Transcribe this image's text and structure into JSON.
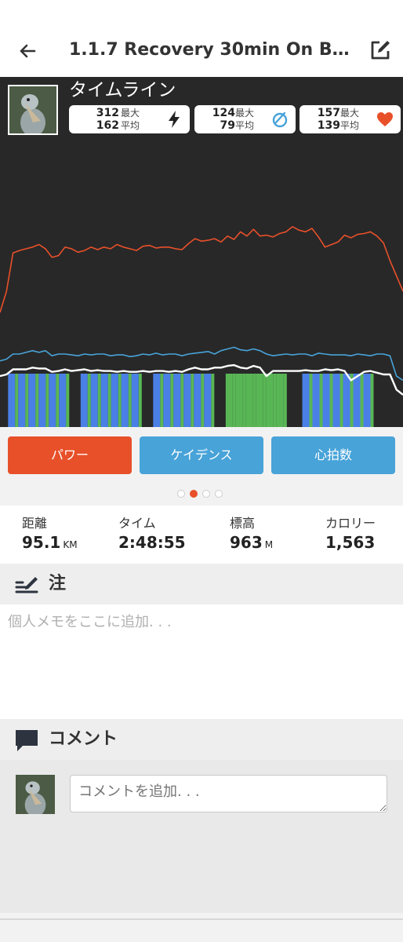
{
  "header": {
    "title": "1.1.7 Recovery 30min On B...",
    "back_icon": "arrow-left-icon",
    "edit_icon": "edit-icon"
  },
  "timeline": {
    "title": "タイムライン",
    "stats": [
      {
        "max": "312",
        "avg": "162",
        "max_label": "最大",
        "avg_label": "平均",
        "icon": "lightning-icon"
      },
      {
        "max": "124",
        "avg": "79",
        "max_label": "最大",
        "avg_label": "平均",
        "icon": "cadence-icon"
      },
      {
        "max": "157",
        "avg": "139",
        "max_label": "最大",
        "avg_label": "平均",
        "icon": "heart-icon"
      }
    ]
  },
  "chart_data": {
    "type": "line",
    "series": [
      {
        "name": "パワー",
        "color": "#e8502a",
        "values": [
          135,
          160,
          205,
          208,
          210,
          212,
          215,
          210,
          200,
          202,
          212,
          210,
          206,
          208,
          212,
          209,
          212,
          210,
          215,
          212,
          210,
          208,
          213,
          214,
          211,
          212,
          212,
          210,
          209,
          216,
          222,
          219,
          220,
          222,
          218,
          225,
          221,
          230,
          225,
          233,
          225,
          226,
          224,
          228,
          230,
          236,
          232,
          230,
          234,
          224,
          212,
          215,
          218,
          226,
          223,
          227,
          228,
          230,
          225,
          217,
          196,
          178,
          160
        ]
      },
      {
        "name": "ケイデンス",
        "color": "#48a3d8",
        "values": [
          78,
          80,
          86,
          86,
          88,
          90,
          88,
          90,
          84,
          86,
          86,
          85,
          84,
          86,
          85,
          86,
          86,
          84,
          85,
          85,
          83,
          84,
          86,
          85,
          87,
          85,
          86,
          86,
          84,
          86,
          87,
          88,
          89,
          86,
          90,
          92,
          94,
          91,
          90,
          92,
          90,
          86,
          84,
          85,
          86,
          85,
          86,
          86,
          84,
          87,
          86,
          85,
          85,
          85,
          84,
          86,
          85,
          84,
          86,
          86,
          84,
          60,
          55
        ]
      },
      {
        "name": "心拍数",
        "color": "#ffffff",
        "values": [
          60,
          62,
          68,
          68,
          68,
          70,
          69,
          69,
          65,
          66,
          68,
          66,
          67,
          68,
          66,
          67,
          66,
          66,
          65,
          66,
          65,
          65,
          66,
          65,
          66,
          66,
          65,
          66,
          65,
          68,
          70,
          68,
          68,
          70,
          70,
          72,
          73,
          70,
          69,
          72,
          70,
          60,
          66,
          66,
          66,
          66,
          66,
          67,
          66,
          66,
          68,
          67,
          68,
          66,
          55,
          60,
          65,
          66,
          64,
          62,
          62,
          44,
          38
        ]
      }
    ],
    "intervals": [
      {
        "start": 0.02,
        "end": 0.18,
        "color": "#4a7fe6"
      },
      {
        "start": 0.2,
        "end": 0.35,
        "color": "#4a7fe6"
      },
      {
        "start": 0.38,
        "end": 0.54,
        "color": "#4a7fe6"
      },
      {
        "start": 0.56,
        "end": 0.72,
        "color": "#59b655"
      },
      {
        "start": 0.75,
        "end": 0.92,
        "color": "#4a7fe6"
      }
    ]
  },
  "buttons": {
    "power": "パワー",
    "cadence": "ケイデンス",
    "heart": "心拍数"
  },
  "pager": {
    "count": 4,
    "active": 1
  },
  "metrics": [
    {
      "label": "距離",
      "value": "95.1",
      "unit": "KM"
    },
    {
      "label": "タイム",
      "value": "2:48:55",
      "unit": ""
    },
    {
      "label": "標高",
      "value": "963",
      "unit": "M"
    },
    {
      "label": "カロリー",
      "value": "1,563",
      "unit": ""
    }
  ],
  "notes": {
    "title": "注",
    "placeholder": "個人メモをここに追加. . ."
  },
  "comments": {
    "title": "コメント",
    "placeholder": "コメントを追加. . ."
  }
}
